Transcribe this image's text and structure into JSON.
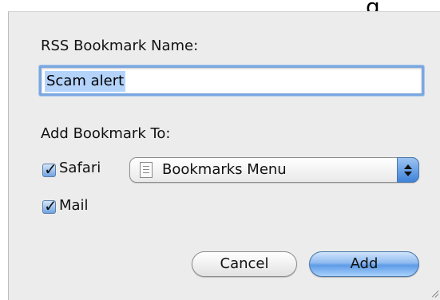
{
  "dialog": {
    "name_label": "RSS Bookmark Name:",
    "name_value": "Scam alert",
    "add_to_label": "Add Bookmark To:",
    "safari": {
      "label": "Safari",
      "checked": true
    },
    "mail": {
      "label": "Mail",
      "checked": true
    },
    "bookmark_location": {
      "selected": "Bookmarks Menu"
    },
    "buttons": {
      "cancel": "Cancel",
      "add": "Add"
    }
  },
  "icons": {
    "popup": "document-list-icon",
    "popup_stepper": "up-down-arrows-icon",
    "resize": "resize-grip-icon"
  },
  "colors": {
    "dialog_background": "#ececec",
    "focus_ring": "#7ba7e1",
    "text_selection": "#b3d3fb",
    "default_button": "#5d9be7"
  }
}
